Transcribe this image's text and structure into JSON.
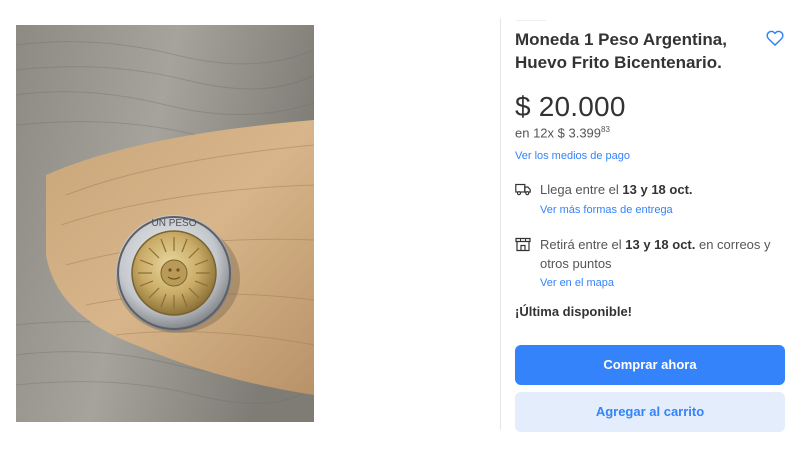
{
  "product": {
    "title_line1": "Moneda 1 Peso Argentina,",
    "title_line2": "Huevo Frito Bicentenario.",
    "image_alt": "coin-photo",
    "coin_text": "UN PESO"
  },
  "price": {
    "amount": "$ 20.000",
    "installments_prefix": "en 12x $ 3.399",
    "installments_cents": "83",
    "payment_methods_link": "Ver los medios de pago"
  },
  "shipping": {
    "prefix": "Llega entre el ",
    "date_range": "13 y 18 oct.",
    "more_options_link": "Ver más formas de entrega"
  },
  "pickup": {
    "prefix": "Retirá entre el ",
    "date_range": "13 y 18 oct.",
    "suffix": " en correos y otros puntos",
    "map_link": "Ver en el mapa"
  },
  "stock_message": "¡Última disponible!",
  "actions": {
    "buy_now": "Comprar ahora",
    "add_to_cart": "Agregar al carrito"
  },
  "colors": {
    "accent": "#3483fa",
    "accent_light": "#e3edfb"
  },
  "icons": {
    "favorite": "heart-outline-icon",
    "shipping": "truck-icon",
    "pickup": "store-icon"
  }
}
